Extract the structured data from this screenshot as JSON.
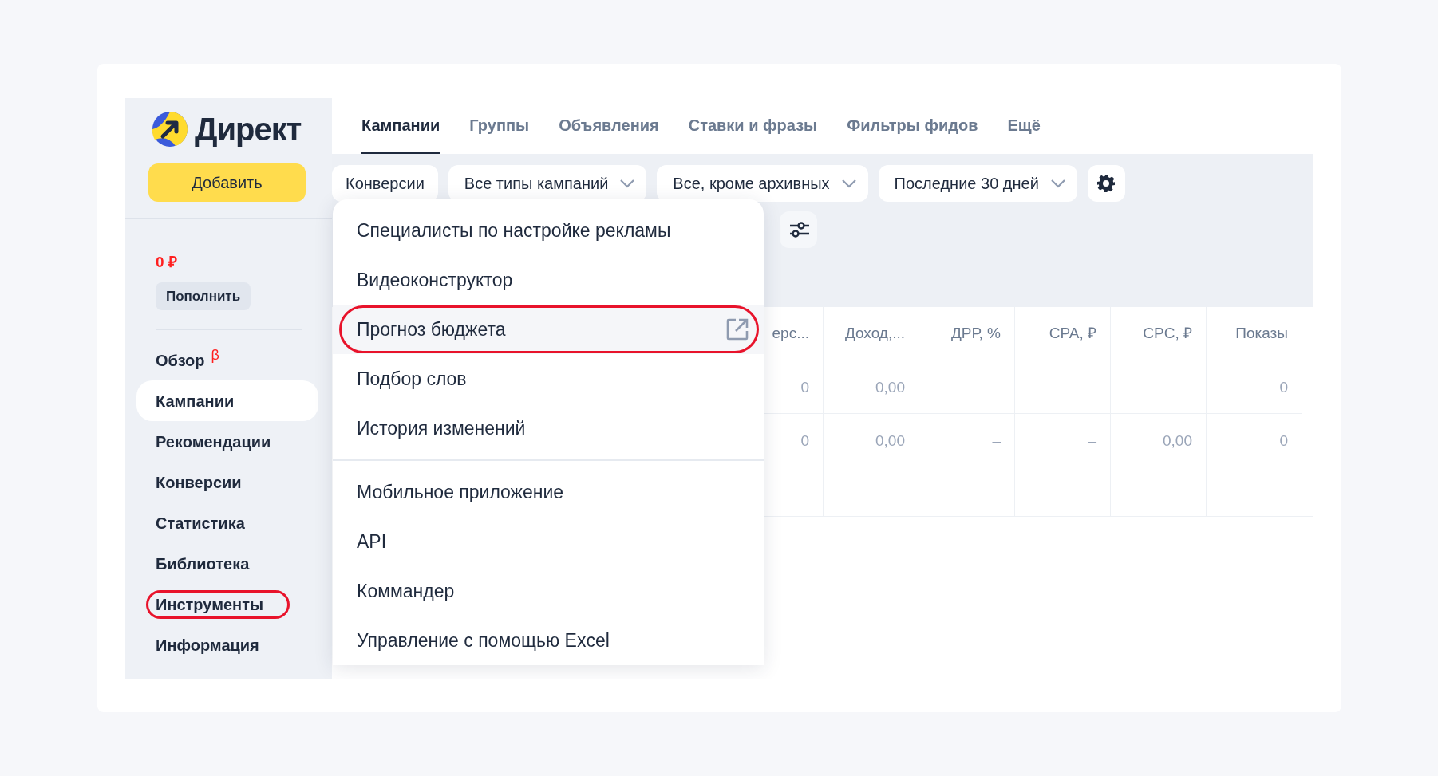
{
  "sidebar": {
    "logo": "Директ",
    "add_button": "Добавить",
    "balance": "0 ₽",
    "top_up_button": "Пополнить",
    "items": [
      {
        "label": "Обзор",
        "badge": "β",
        "selected": false,
        "circled": false
      },
      {
        "label": "Кампании",
        "selected": true,
        "circled": false
      },
      {
        "label": "Рекомендации",
        "selected": false,
        "circled": false
      },
      {
        "label": "Конверсии",
        "selected": false,
        "circled": false
      },
      {
        "label": "Статистика",
        "selected": false,
        "circled": false
      },
      {
        "label": "Библиотека",
        "selected": false,
        "circled": false
      },
      {
        "label": "Инструменты",
        "selected": false,
        "circled": true
      },
      {
        "label": "Информация",
        "selected": false,
        "circled": false
      }
    ]
  },
  "tabs": [
    {
      "label": "Кампании",
      "selected": true
    },
    {
      "label": "Группы",
      "selected": false
    },
    {
      "label": "Объявления",
      "selected": false
    },
    {
      "label": "Ставки и фразы",
      "selected": false
    },
    {
      "label": "Фильтры фидов",
      "selected": false
    },
    {
      "label": "Ещё",
      "selected": false
    }
  ],
  "filters": [
    {
      "label": "Конверсии",
      "kind": "plain"
    },
    {
      "label": "Все типы кампаний",
      "kind": "dropdown"
    },
    {
      "label": "Все, кроме архивных",
      "kind": "dropdown"
    },
    {
      "label": "Последние 30 дней",
      "kind": "dropdown"
    },
    {
      "kind": "settings"
    }
  ],
  "table": {
    "columns": [
      "ерс...",
      "Доход,...",
      "ДРР, %",
      "CPA, ₽",
      "CPC, ₽",
      "Показы"
    ],
    "rows": [
      [
        "0",
        "0,00",
        null,
        null,
        null,
        "0"
      ],
      [
        "0",
        "0,00",
        "–",
        "–",
        "0,00",
        "0"
      ]
    ]
  },
  "menu": {
    "groups": [
      [
        {
          "label": "Специалисты по настройке рекламы",
          "external": false,
          "circled": false
        },
        {
          "label": "Видеоконструктор",
          "external": false,
          "circled": false
        },
        {
          "label": "Прогноз бюджета",
          "external": true,
          "circled": true
        },
        {
          "label": "Подбор слов",
          "external": false,
          "circled": false
        },
        {
          "label": "История изменений",
          "external": false,
          "circled": false
        }
      ],
      [
        {
          "label": "Мобильное приложение",
          "external": false,
          "circled": false
        },
        {
          "label": "API",
          "external": false,
          "circled": false
        },
        {
          "label": "Коммандер",
          "external": false,
          "circled": false
        },
        {
          "label": "Управление с помощью Excel",
          "external": false,
          "circled": false
        }
      ]
    ]
  }
}
